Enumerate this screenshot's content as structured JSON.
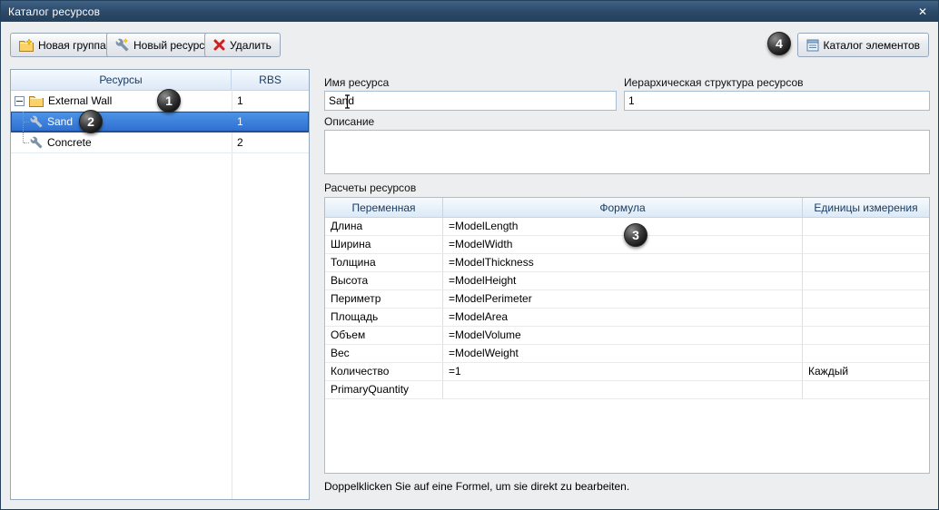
{
  "window": {
    "title": "Каталог ресурсов",
    "close_glyph": "✕"
  },
  "toolbar": {
    "new_group": "Новая группа",
    "new_resource": "Новый ресурс",
    "delete": "Удалить",
    "element_catalog": "Каталог элементов"
  },
  "tree": {
    "headers": {
      "resources": "Ресурсы",
      "rbs": "RBS"
    },
    "rows": [
      {
        "label": "External Wall",
        "rbs": "1",
        "type": "folder",
        "selected": false
      },
      {
        "label": "Sand",
        "rbs": "1",
        "type": "resource",
        "selected": true
      },
      {
        "label": "Concrete",
        "rbs": "2",
        "type": "resource",
        "selected": false
      }
    ]
  },
  "form": {
    "name_label": "Имя ресурса",
    "name_value": "Sand",
    "hierarchy_label": "Иерархическая структура ресурсов",
    "hierarchy_value": "1",
    "description_label": "Описание",
    "description_value": "",
    "calculations_label": "Расчеты ресурсов"
  },
  "calc_table": {
    "headers": [
      "Переменная",
      "Формула",
      "Единицы измерения"
    ],
    "rows": [
      {
        "variable": "Длина",
        "formula": "=ModelLength",
        "unit": ""
      },
      {
        "variable": "Ширина",
        "formula": "=ModelWidth",
        "unit": ""
      },
      {
        "variable": "Толщина",
        "formula": "=ModelThickness",
        "unit": ""
      },
      {
        "variable": "Высота",
        "formula": "=ModelHeight",
        "unit": ""
      },
      {
        "variable": "Периметр",
        "formula": "=ModelPerimeter",
        "unit": ""
      },
      {
        "variable": "Площадь",
        "formula": "=ModelArea",
        "unit": ""
      },
      {
        "variable": "Объем",
        "formula": "=ModelVolume",
        "unit": ""
      },
      {
        "variable": "Вес",
        "formula": "=ModelWeight",
        "unit": ""
      },
      {
        "variable": "Количество",
        "formula": "=1",
        "unit": "Каждый"
      },
      {
        "variable": "PrimaryQuantity",
        "formula": "",
        "unit": ""
      }
    ]
  },
  "footer": {
    "hint": "Doppelklicken Sie auf eine Formel, um sie direkt zu bearbeiten."
  },
  "annotations": {
    "badge1": "1",
    "badge2": "2",
    "badge3": "3",
    "badge4": "4"
  },
  "colors": {
    "titlebar": "#2c4a68",
    "selection": "#3a7edb",
    "table_header_bg": "#e3edf8",
    "grid_border": "#c3d5e8",
    "badge_bg": "#000000"
  }
}
